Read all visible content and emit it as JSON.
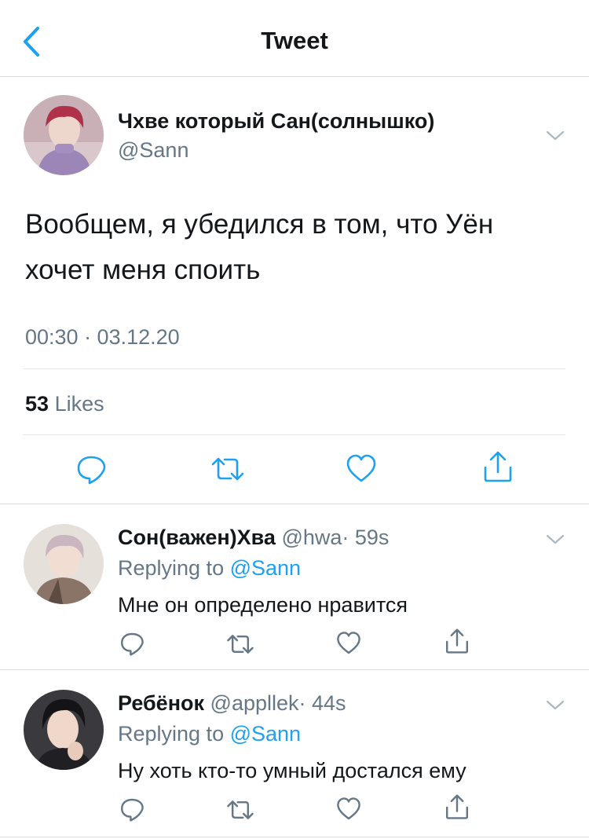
{
  "header": {
    "title": "Tweet"
  },
  "main_tweet": {
    "author_name": "Чхве который Сан(солнышко)",
    "author_handle": "@Sann",
    "text_line1": "Вообщем, я убедился в том, что Уён",
    "text_line2": "хочет меня споить",
    "timestamp": "00:30 · 03.12.20",
    "likes_count": "53",
    "likes_label": "Likes"
  },
  "replies": [
    {
      "name": "Сон(важен)Хва",
      "handle": "@hwa",
      "time": "· 59s",
      "replying_prefix": "Replying to",
      "replying_to": "@Sann",
      "text": "Мне он определено нравится"
    },
    {
      "name": "Ребёнок",
      "handle": "@appllek",
      "time": "· 44s",
      "replying_prefix": "Replying to",
      "replying_to": "@Sann",
      "text": "Ну хоть кто-то умный достался ему"
    }
  ],
  "icons": {
    "back": "back-arrow-icon",
    "menu": "chevron-down-icon",
    "reply": "reply-icon",
    "retweet": "retweet-icon",
    "like": "heart-icon",
    "share": "share-icon"
  },
  "colors": {
    "accent": "#1da1f2",
    "secondary_text": "#657786",
    "primary_text": "#14171a",
    "divider": "#d9dde1"
  }
}
